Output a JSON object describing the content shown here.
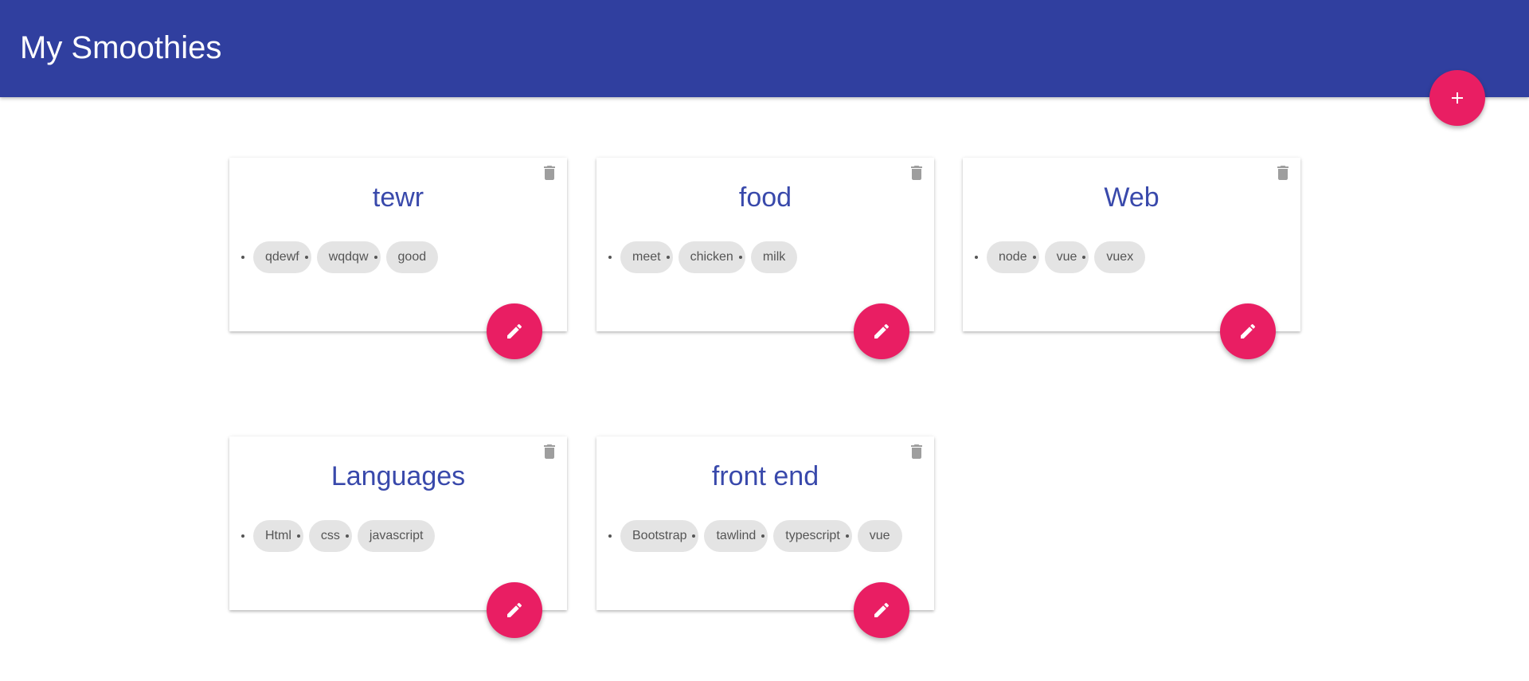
{
  "header": {
    "title": "My Smoothies",
    "color": "#303f9f"
  },
  "add_button": {
    "icon": "plus-icon",
    "color": "#e91e63"
  },
  "smoothies": [
    {
      "title": "tewr",
      "ingredients": [
        "qdewf",
        "wqdqw",
        "good"
      ]
    },
    {
      "title": "food",
      "ingredients": [
        "meet",
        "chicken",
        "milk"
      ]
    },
    {
      "title": "Web",
      "ingredients": [
        "node",
        "vue",
        "vuex"
      ]
    },
    {
      "title": "Languages",
      "ingredients": [
        "Html",
        "css",
        "javascript"
      ]
    },
    {
      "title": "front end",
      "ingredients": [
        "Bootstrap",
        "tawlind",
        "typescript",
        "vue"
      ]
    }
  ],
  "icons": {
    "delete": "trash-icon",
    "edit": "pencil-icon"
  },
  "colors": {
    "accent": "#e91e63",
    "title_text": "#3949ab",
    "chip_bg": "#e4e4e4",
    "trash": "#9e9e9e"
  }
}
